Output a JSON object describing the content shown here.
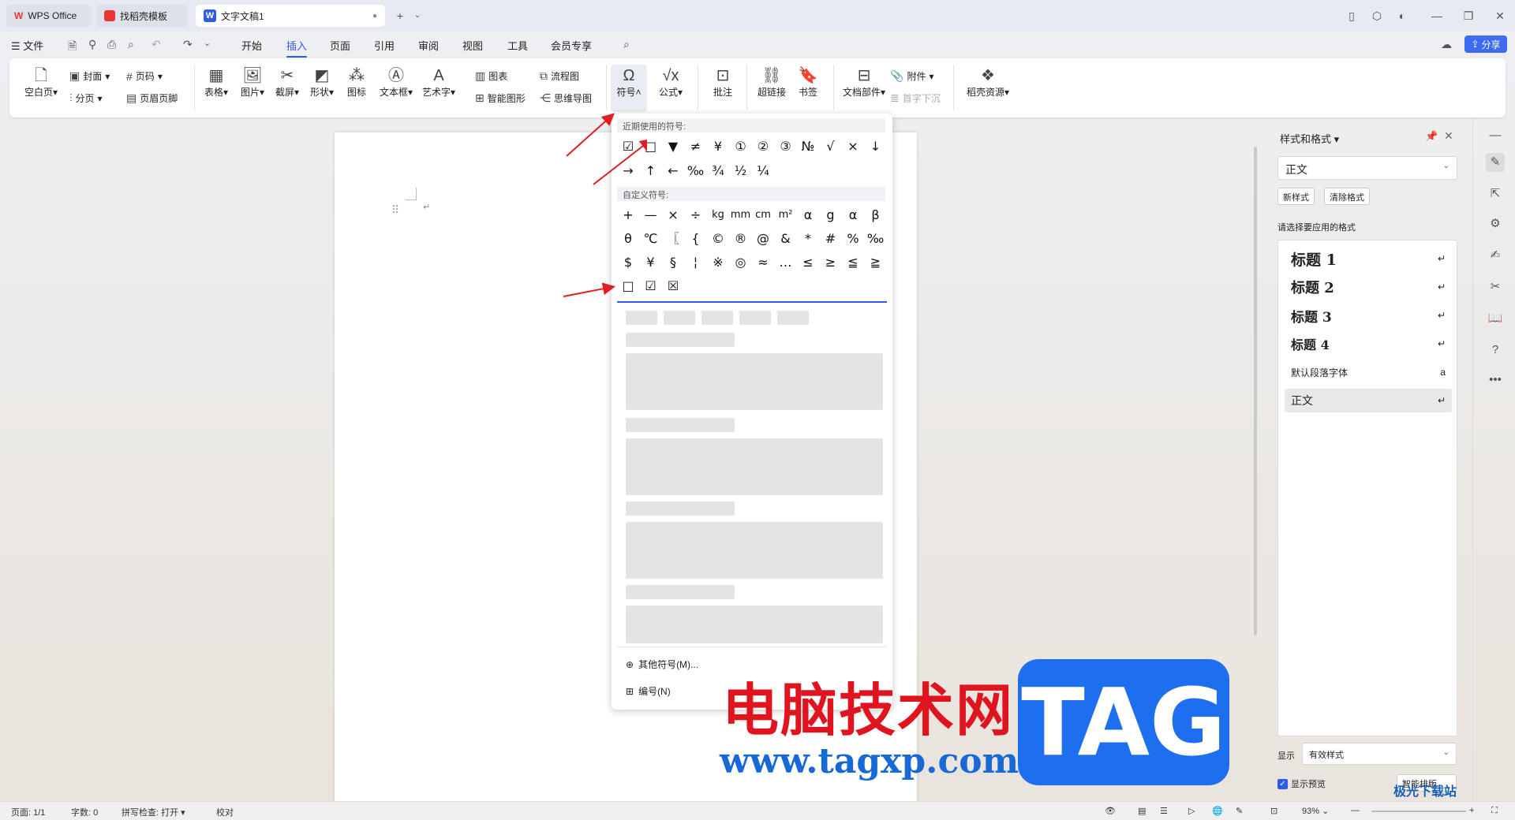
{
  "tabs": [
    {
      "label": "WPS Office"
    },
    {
      "label": "找稻壳模板"
    },
    {
      "label": "文字文稿1"
    }
  ],
  "menu": {
    "file": "文件",
    "items": [
      "开始",
      "插入",
      "页面",
      "引用",
      "审阅",
      "视图",
      "工具",
      "会员专享"
    ],
    "active": "插入",
    "share": "分享"
  },
  "ribbon": {
    "blank_page": "空白页",
    "cover": "封面",
    "page_break": "分页",
    "page_num": "页码",
    "header_footer": "页眉页脚",
    "table": "表格",
    "picture": "图片",
    "screenshot": "截屏",
    "shape": "形状",
    "icon": "图标",
    "textbox": "文本框",
    "wordart": "艺术字",
    "chart": "图表",
    "smart_graphic": "智能图形",
    "flowchart": "流程图",
    "mindmap": "思维导图",
    "symbol": "符号",
    "formula": "公式",
    "comment": "批注",
    "hyperlink": "超链接",
    "bookmark": "书签",
    "doc_parts": "文档部件",
    "attachment": "附件",
    "drop_cap": "首字下沉",
    "resources": "稻壳资源"
  },
  "symbol_panel": {
    "recent_label": "近期使用的符号:",
    "recent_row1": [
      "☑",
      "□",
      "▼",
      "≠",
      "¥",
      "①",
      "②",
      "③",
      "№",
      "√",
      "×",
      "↓"
    ],
    "recent_row2": [
      "→",
      "↑",
      "←",
      "‰",
      "¾",
      "½",
      "¼"
    ],
    "custom_label": "自定义符号:",
    "custom_row1": [
      "+",
      "—",
      "×",
      "÷",
      "kg",
      "mm",
      "cm",
      "m²",
      "α",
      "g",
      "α",
      "β"
    ],
    "custom_row2": [
      "θ",
      "℃",
      "〖",
      "{",
      "©",
      "®",
      "@",
      "&",
      "*",
      "#",
      "%",
      "‰"
    ],
    "custom_row3": [
      "$",
      "¥",
      "§",
      "¦",
      "※",
      "◎",
      "≈",
      "…",
      "≤",
      "≥",
      "≦",
      "≧"
    ],
    "custom_row4": [
      "□",
      "☑",
      "☒"
    ],
    "more_symbols": "其他符号(M)...",
    "numbering": "编号(N)"
  },
  "styles_pane": {
    "title": "样式和格式",
    "current": "正文",
    "new_style": "新样式",
    "clear_format": "清除格式",
    "prompt": "请选择要应用的格式",
    "items": [
      {
        "label": "标题  1"
      },
      {
        "label": "标题  2"
      },
      {
        "label": "标题  3"
      },
      {
        "label": "标题 4"
      },
      {
        "label": "默认段落字体"
      },
      {
        "label": "正文"
      }
    ],
    "show_label": "显示",
    "show_value": "有效样式",
    "preview": "显示预览",
    "smart": "智能排版"
  },
  "status": {
    "page": "页面: 1/1",
    "words": "字数: 0",
    "spell": "拼写检查: 打开",
    "proof": "校对",
    "zoom": "93%"
  },
  "watermark": {
    "cn": "电脑技术网",
    "url": "www.tagxp.com",
    "tag": "TAG",
    "site": "极光下载站"
  },
  "colors": {
    "accent": "#2f5be8",
    "arrow": "#e02020"
  }
}
